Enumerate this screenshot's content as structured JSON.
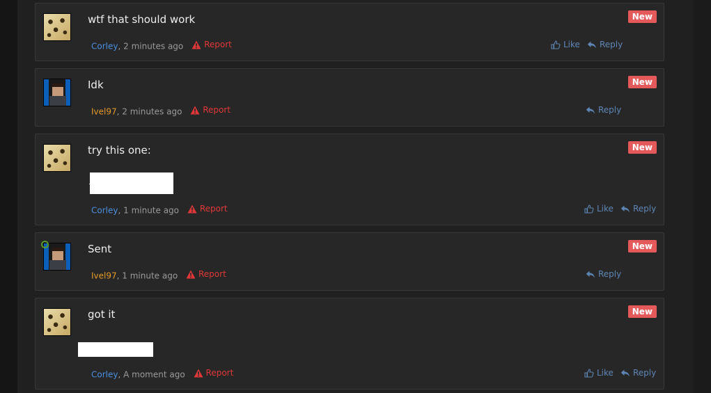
{
  "badge_label": "New",
  "report_label": "Report",
  "like_label": "Like",
  "reply_label": "Reply",
  "comments": [
    {
      "text": "wtf that should work",
      "author": "Corley",
      "time": ", 2 minutes ago"
    },
    {
      "text": "Idk",
      "author": "Ivel97",
      "time": ", 2 minutes ago"
    },
    {
      "text": "try this one:",
      "author": "Corley",
      "time": ", 1 minute ago"
    },
    {
      "text": "Sent",
      "author": "Ivel97",
      "time": ", 1 minute ago"
    },
    {
      "text": "got it",
      "author": "Corley",
      "time": ", A moment ago"
    }
  ],
  "colors": {
    "author_corley": "#4a8fe0",
    "author_ivel": "#e49a28",
    "report": "#e03838",
    "action": "#5d86b5",
    "badge": "#e45a5a"
  }
}
